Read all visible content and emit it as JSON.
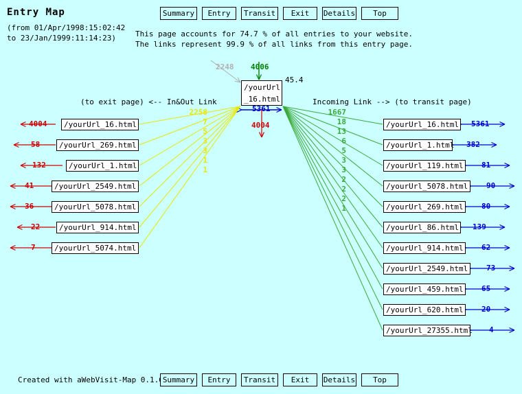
{
  "page": {
    "title": "Entry Map",
    "date_range_line1": "(from 01/Apr/1998:15:02:42",
    "date_range_line2": "to 23/Jan/1999:11:14:23)",
    "intro_line1": "This page accounts for 74.7 % of all entries to your website.",
    "intro_line2": "The links represent 99.9 % of all links from this entry page.",
    "credit": "Created with aWebVisit-Map 0.1.6",
    "background_color": "#ccffff"
  },
  "nav": {
    "items": [
      {
        "label": "Summary"
      },
      {
        "label": "Entry"
      },
      {
        "label": "Transit"
      },
      {
        "label": "Exit"
      },
      {
        "label": "Details"
      },
      {
        "label": "Top"
      }
    ]
  },
  "columns": {
    "left_header": "(to exit page) <-- In&Out Link",
    "right_header": "Incoming Link --> (to transit page)"
  },
  "center": {
    "url_line1": "/yourUrl",
    "url_line2": "_16.html",
    "percent": "45.4",
    "in_gray": "2248",
    "in_green": "4006",
    "inout_blue": "5361",
    "out_red": "4004",
    "colors": {
      "gray": "#b0b0b0",
      "green": "#008000",
      "blue": "#0000cc",
      "red": "#cc0000",
      "yellow": "#e8e800",
      "fan_green": "#3aaa3a"
    }
  },
  "chart_data": {
    "type": "diagram",
    "title": "Entry Map",
    "center_node": "/yourUrl_16.html",
    "center_percent": 45.4,
    "left_fan_values": [
      2258,
      7,
      5,
      3,
      3,
      1,
      1
    ],
    "right_fan_values": [
      1667,
      18,
      13,
      6,
      5,
      3,
      3,
      2,
      2,
      2,
      1
    ],
    "left_nodes": [
      {
        "url": "/yourUrl_16.html",
        "value": "4004"
      },
      {
        "url": "/yourUrl_269.html",
        "value": "58"
      },
      {
        "url": "/yourUrl_1.html",
        "value": "132"
      },
      {
        "url": "/yourUrl_2549.html",
        "value": "41"
      },
      {
        "url": "/yourUrl_5078.html",
        "value": "36"
      },
      {
        "url": "/yourUrl_914.html",
        "value": "22"
      },
      {
        "url": "/yourUrl_5074.html",
        "value": "7"
      }
    ],
    "right_nodes": [
      {
        "url": "/yourUrl_16.html",
        "value": "5361"
      },
      {
        "url": "/yourUrl_1.html",
        "value": "382"
      },
      {
        "url": "/yourUrl_119.html",
        "value": "81"
      },
      {
        "url": "/yourUrl_5078.html",
        "value": "90"
      },
      {
        "url": "/yourUrl_269.html",
        "value": "80"
      },
      {
        "url": "/yourUrl_86.html",
        "value": "139"
      },
      {
        "url": "/yourUrl_914.html",
        "value": "62"
      },
      {
        "url": "/yourUrl_2549.html",
        "value": "73"
      },
      {
        "url": "/yourUrl_459.html",
        "value": "65"
      },
      {
        "url": "/yourUrl_620.html",
        "value": "20"
      },
      {
        "url": "/yourUrl_27355.html",
        "value": "4"
      }
    ]
  }
}
